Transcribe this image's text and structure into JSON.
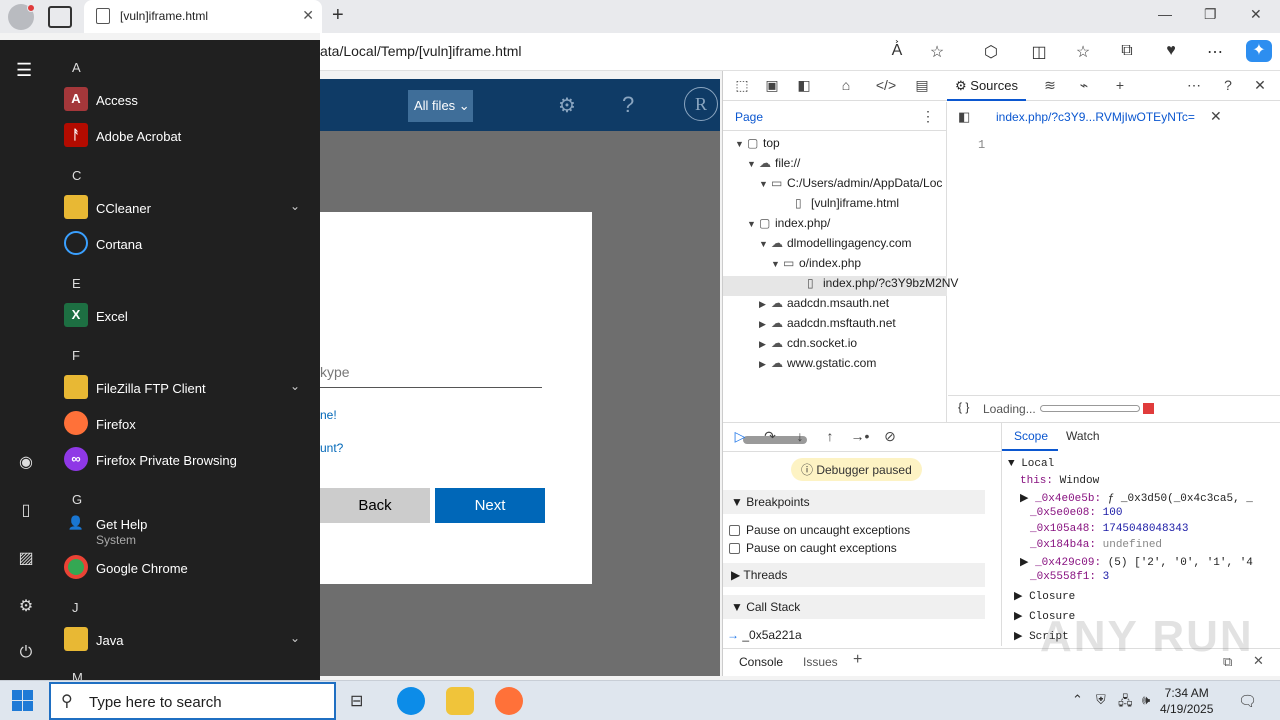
{
  "browser": {
    "tab_title": "[vuln]iframe.html",
    "url": "ata/Local/Temp/[vuln]iframe.html"
  },
  "webpage": {
    "all_files_label": "All files",
    "avatar_letter": "R",
    "email_placeholder": "kype",
    "link1": "ne!",
    "link2": "unt?",
    "back_label": "Back",
    "next_label": "Next"
  },
  "devtools": {
    "sources_tab": "Sources",
    "page_tab": "Page",
    "tree": [
      {
        "label": "top",
        "arrow": "▼",
        "icon": "▢"
      },
      {
        "label": "file://",
        "arrow": "▼",
        "icon": "☁"
      },
      {
        "label": "C:/Users/admin/AppData/Loc",
        "arrow": "▼",
        "icon": "▭"
      },
      {
        "label": "[vuln]iframe.html",
        "arrow": "",
        "icon": "▯"
      },
      {
        "label": "index.php/",
        "arrow": "▼",
        "icon": "▢"
      },
      {
        "label": "dlmodellingagency.com",
        "arrow": "▼",
        "icon": "☁"
      },
      {
        "label": "o/index.php",
        "arrow": "▼",
        "icon": "▭"
      },
      {
        "label": "index.php/?c3Y9bzM2NV",
        "arrow": "",
        "icon": "▯"
      },
      {
        "label": "aadcdn.msauth.net",
        "arrow": "▶",
        "icon": "☁"
      },
      {
        "label": "aadcdn.msftauth.net",
        "arrow": "▶",
        "icon": "☁"
      },
      {
        "label": "cdn.socket.io",
        "arrow": "▶",
        "icon": "☁"
      },
      {
        "label": "www.gstatic.com",
        "arrow": "▶",
        "icon": "☁"
      }
    ],
    "editor_tab": "index.php/?c3Y9...RVMjIwOTEyNTc=",
    "editor_line": "1",
    "loading": "Loading...",
    "debugger_paused": "Debugger paused",
    "breakpoints": "Breakpoints",
    "pause_uncaught": "Pause on uncaught exceptions",
    "pause_caught": "Pause on caught exceptions",
    "threads": "Threads",
    "call_stack": "Call Stack",
    "stack_frame": "_0x5a221a",
    "scope_tab": "Scope",
    "watch_tab": "Watch",
    "scope": {
      "local": "Local",
      "this_key": "this:",
      "this_val": "Window",
      "f1_key": "_0x4e0e5b:",
      "f1_val": "ƒ _0x3d50(_0x4c3ca5, _",
      "f2_key": "_0x5e0e08:",
      "f2_val": "100",
      "f3_key": "_0x105a48:",
      "f3_val": "1745048048343",
      "f4_key": "_0x184b4a:",
      "f4_val": "undefined",
      "f5_key": "_0x429c09:",
      "f5_val": "(5) ['2', '0', '1', '4",
      "f6_key": "_0x5558f1:",
      "f6_val": "3",
      "closure1": "Closure",
      "closure2": "Closure",
      "script": "Script"
    },
    "console_tab": "Console",
    "issues_tab": "Issues"
  },
  "start_menu": {
    "groups": {
      "a": "A",
      "c": "C",
      "e": "E",
      "f": "F",
      "g": "G",
      "j": "J",
      "m": "M"
    },
    "apps": {
      "access": "Access",
      "acrobat": "Adobe Acrobat",
      "ccleaner": "CCleaner",
      "cortana": "Cortana",
      "excel": "Excel",
      "filezilla": "FileZilla FTP Client",
      "firefox": "Firefox",
      "firefox_private": "Firefox Private Browsing",
      "get_help": "Get Help",
      "get_help_sub": "System",
      "chrome": "Google Chrome",
      "java": "Java"
    }
  },
  "taskbar": {
    "search_placeholder": "Type here to search",
    "time": "7:34 AM",
    "date": "4/19/2025"
  },
  "watermark": "ANY RUN"
}
